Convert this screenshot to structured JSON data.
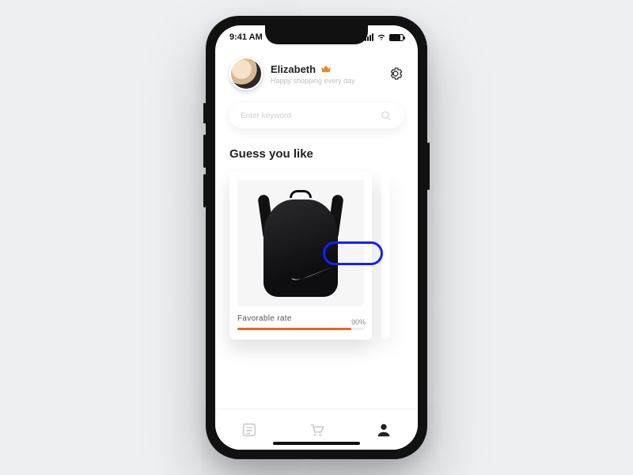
{
  "status": {
    "time": "9:41 AM"
  },
  "header": {
    "user_name": "Elizabeth",
    "subtitle": "Happy shopping every day"
  },
  "search": {
    "placeholder": "Enter keyword"
  },
  "section": {
    "title": "Guess you like"
  },
  "product": {
    "favorable_label": "Favorable rate",
    "favorable_value": "90%",
    "favorable_pct": 90
  },
  "colors": {
    "accent_orange": "#e06a1b",
    "pill_blue": "#1220ff"
  },
  "icons": {
    "crown": "crown-icon",
    "settings": "gear-icon",
    "search": "search-icon",
    "tab_list": "list-icon",
    "tab_cart": "cart-icon",
    "tab_profile": "profile-icon"
  }
}
